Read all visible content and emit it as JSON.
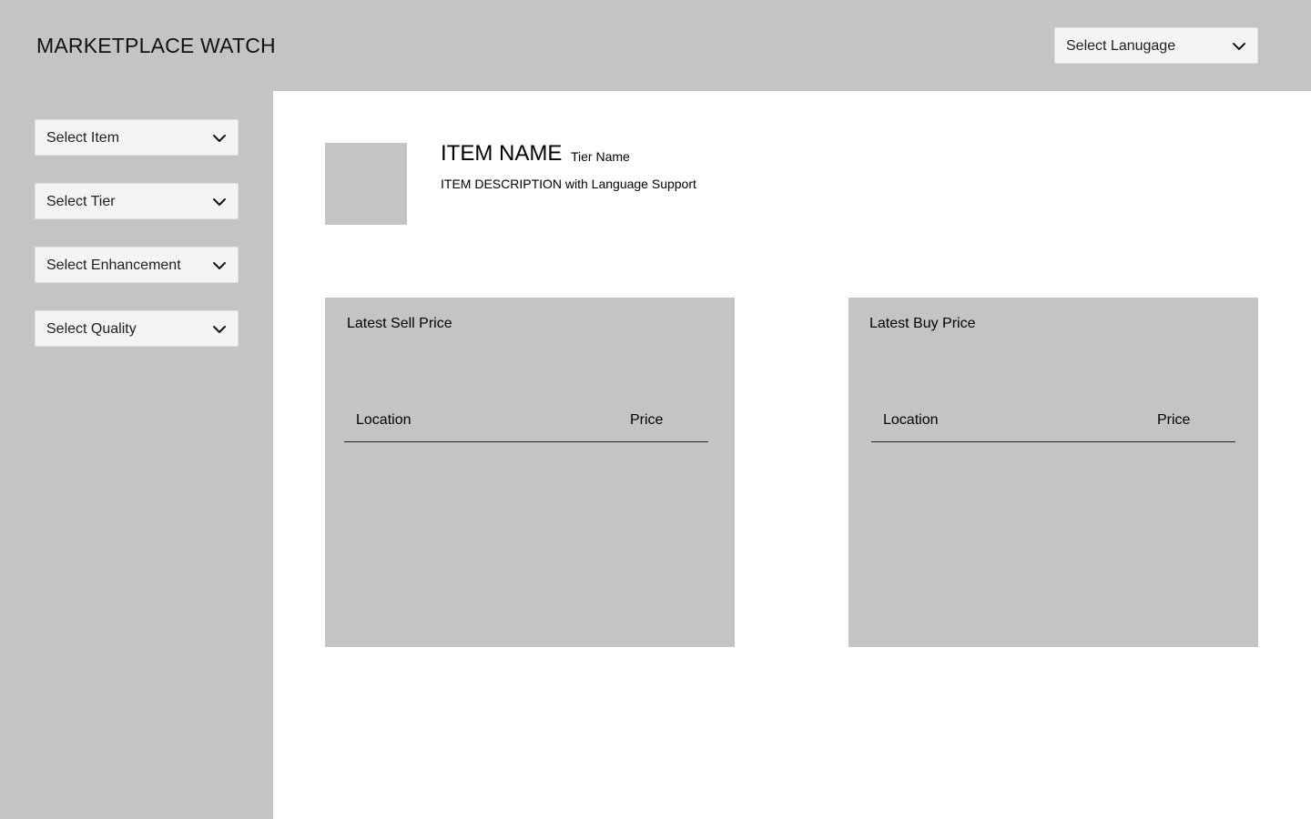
{
  "header": {
    "title": "MARKETPLACE WATCH",
    "language_select": {
      "label": "Select Lanugage",
      "icon": "chevron-down-icon"
    }
  },
  "sidebar": {
    "filters": [
      {
        "label": "Select Item"
      },
      {
        "label": "Select Tier"
      },
      {
        "label": "Select Enhancement"
      },
      {
        "label": "Select Quality"
      }
    ]
  },
  "item": {
    "name": "ITEM NAME",
    "tier": "Tier Name",
    "description": "ITEM DESCRIPTION with Language Support"
  },
  "sell_panel": {
    "title": "Latest Sell Price",
    "columns": [
      "Location",
      "Price"
    ]
  },
  "buy_panel": {
    "title": "Latest Buy Price",
    "columns": [
      "Location",
      "Price"
    ]
  },
  "colors": {
    "placeholder_gray": "#c4c4c4",
    "dropdown_bg": "#f4f4f6",
    "main_bg": "#ffffff"
  }
}
